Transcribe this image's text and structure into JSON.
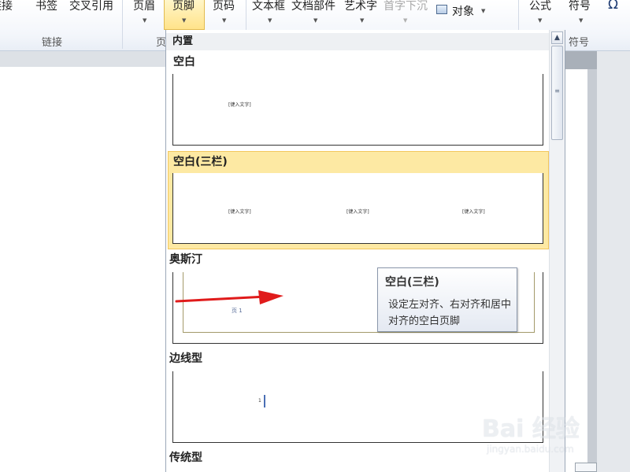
{
  "ribbon": {
    "insert_link": "超链接",
    "bookmark": "书签",
    "cross_ref": "交叉引用",
    "group_links": "链接",
    "header": "页眉",
    "footer": "页脚",
    "page_num": "页码",
    "group_header_footer_partial": "页",
    "textbox": "文本框",
    "quick_parts": "文档部件",
    "wordart": "艺术字",
    "dropcap": "首字下沉",
    "object": "对象",
    "equation": "公式",
    "symbol": "符号",
    "group_symbols": "符号"
  },
  "gallery": {
    "section_title": "内置",
    "placeholder": "[键入文字]",
    "page_label": "页 1",
    "page_number": "1",
    "items": [
      {
        "label": "空白"
      },
      {
        "label": "空白(三栏)"
      },
      {
        "label": "奥斯汀"
      },
      {
        "label": "边线型"
      },
      {
        "label": "传统型"
      }
    ]
  },
  "tooltip": {
    "title": "空白(三栏)",
    "description": "设定左对齐、右对齐和居中对齐的空白页脚"
  },
  "watermark": {
    "main": "Bai 经验",
    "sub": "jingyan.baidu.com"
  },
  "colors": {
    "selected_bg": "#fde9a3",
    "selected_border": "#f3c75e",
    "arrow": "#e01b1b",
    "austin_border": "#a39a6a"
  }
}
